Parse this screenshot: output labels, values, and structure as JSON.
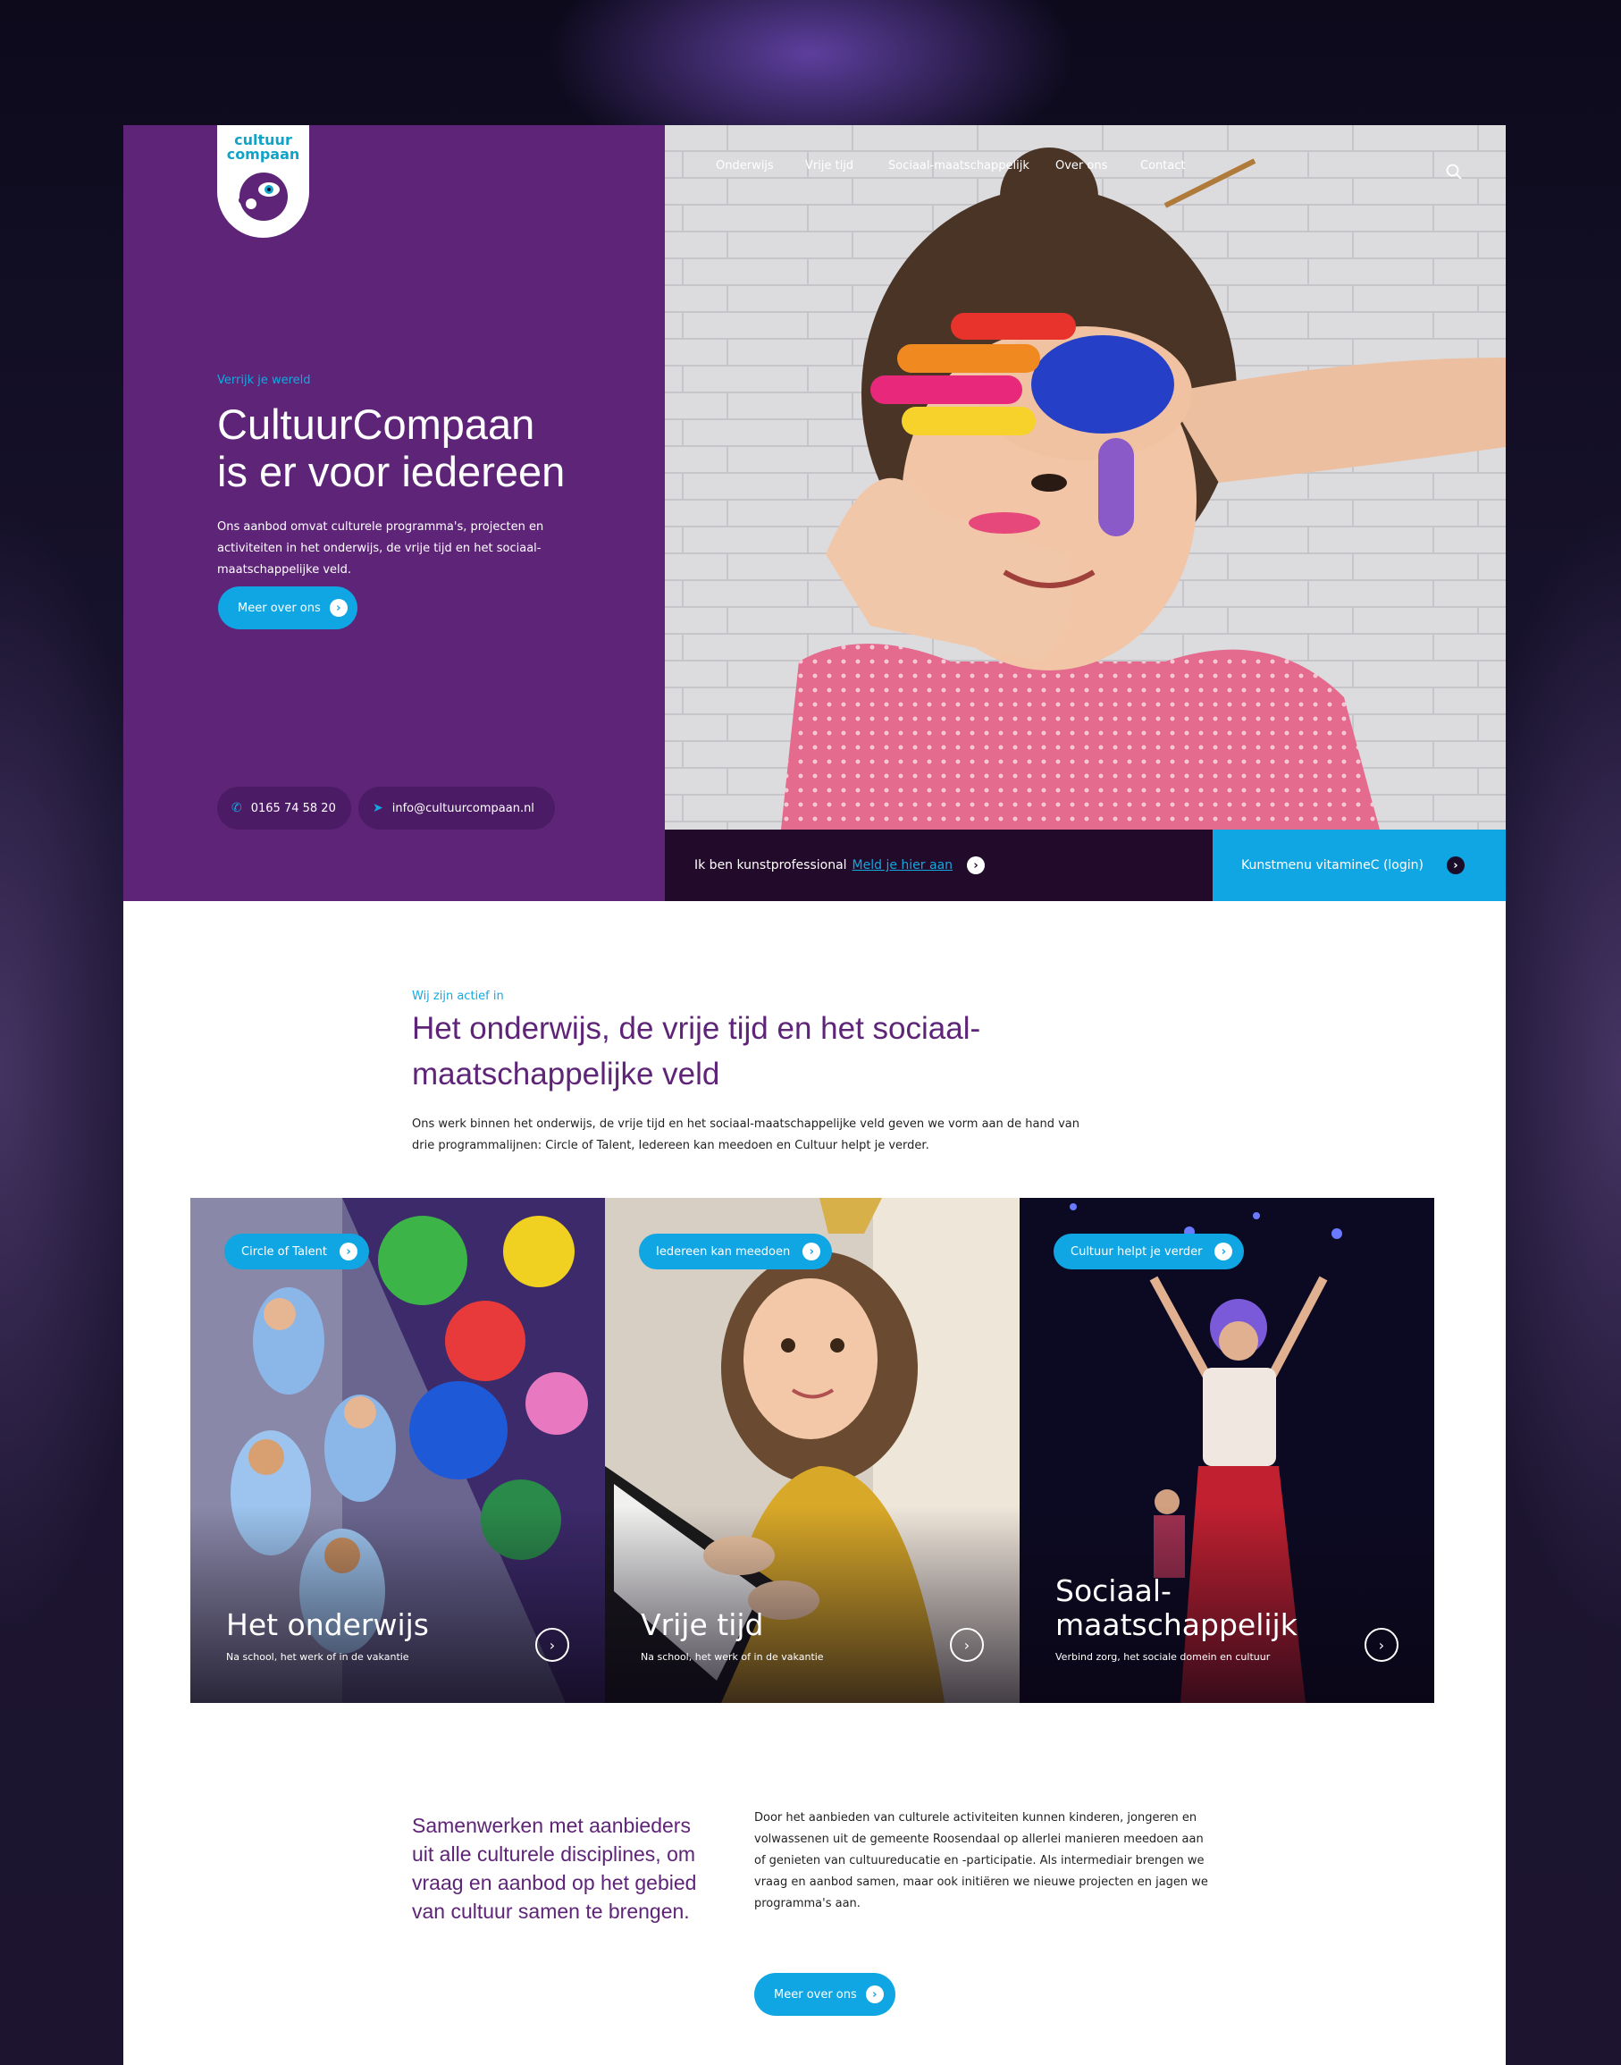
{
  "brand": {
    "logo_line1": "cultuur",
    "logo_line2": "compaan",
    "purple": "#5e2478",
    "cyan": "#10a6e4",
    "dark": "#220a2a"
  },
  "nav": {
    "items": [
      "Onderwijs",
      "Vrije tijd",
      "Sociaal-maatschappelijk",
      "Over ons",
      "Contact"
    ],
    "search_icon": "search-icon"
  },
  "hero": {
    "eyebrow": "Verrijk je wereld",
    "title_line1": "CultuurCompaan",
    "title_line2": "is er voor iedereen",
    "text": "Ons aanbod omvat culturele programma's, projecten en activiteiten in het onderwijs, de vrije tijd en het sociaal-maatschappelijke veld.",
    "button": "Meer over ons",
    "phone": "0165 74 58 20",
    "email": "info@cultuurcompaan.nl"
  },
  "bars": {
    "professional_text": "Ik ben kunstprofessional",
    "professional_link": "Meld je hier aan",
    "login": "Kunstmenu vitamineC (login)"
  },
  "active": {
    "eyebrow": "Wij zijn actief in",
    "title": "Het onderwijs, de vrije tijd en het sociaal-maatschappelijke veld",
    "text": "Ons werk binnen het onderwijs, de vrije tijd en het sociaal-maatschappelijke veld geven we vorm aan de hand van drie programmalijnen: Circle of Talent, Iedereen kan meedoen en Cultuur helpt je verder."
  },
  "cards": [
    {
      "tag": "Circle of Talent",
      "title": "Het onderwijs",
      "subtitle": "Na school, het werk of in de vakantie"
    },
    {
      "tag": "Iedereen kan meedoen",
      "title": "Vrije tijd",
      "subtitle": "Na school, het werk of in de vakantie"
    },
    {
      "tag": "Cultuur helpt je verder",
      "title": "Sociaal-maatschappelijk",
      "subtitle": "Verbind zorg, het sociale domein en cultuur"
    }
  ],
  "collab": {
    "title": "Samenwerken met aanbieders uit alle culturele disciplines, om vraag en aanbod op het gebied van cultuur samen te brengen.",
    "text": "Door het aanbieden van culturele activiteiten kunnen kinderen, jongeren en volwassenen uit de gemeente Roosendaal op allerlei manieren meedoen aan of genieten van cultuureducatie en -participatie. Als intermediair brengen we vraag en aanbod samen, maar ook initiëren we nieuwe projecten en jagen we programma's aan.",
    "button": "Meer over ons"
  }
}
